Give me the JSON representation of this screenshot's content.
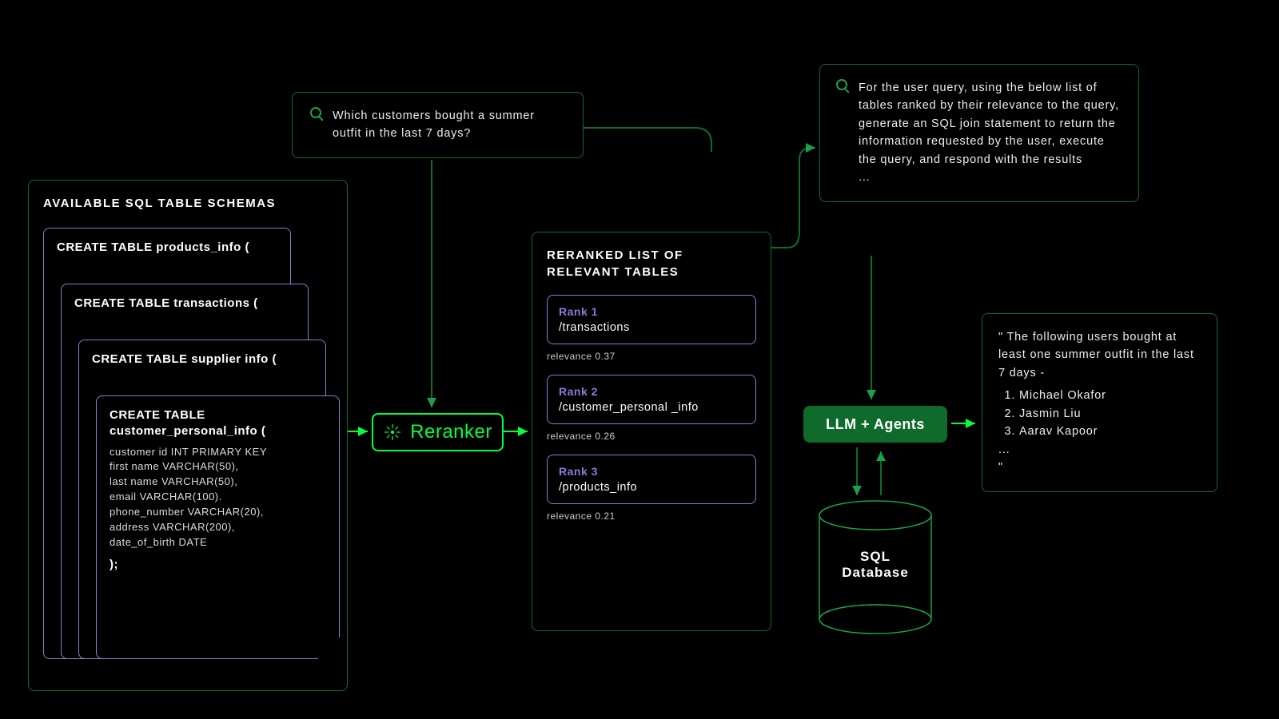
{
  "query_box": {
    "text": "Which customers bought a summer outfit in the last 7 days?"
  },
  "schemas_box": {
    "title": "AVAILABLE SQL TABLE SCHEMAS",
    "cards": [
      {
        "header": "CREATE TABLE products_info ("
      },
      {
        "header": "CREATE TABLE transactions ("
      },
      {
        "header": "CREATE TABLE supplier info ("
      },
      {
        "header": "CREATE TABLE customer_personal_info (",
        "fields": [
          "customer id INT PRIMARY KEY",
          "first name VARCHAR(50),",
          "last name VARCHAR(50),",
          "email VARCHAR(100).",
          "phone_number VARCHAR(20),",
          "address VARCHAR(200),",
          "date_of_birth DATE"
        ],
        "closer": ");"
      }
    ]
  },
  "reranker": {
    "label": "Reranker"
  },
  "reranked_box": {
    "title": "RERANKED LIST OF RELEVANT TABLES",
    "items": [
      {
        "rank": "Rank 1",
        "path": "/transactions",
        "relevance": "relevance 0.37"
      },
      {
        "rank": "Rank 2",
        "path": "/customer_personal _info",
        "relevance": "relevance 0.26"
      },
      {
        "rank": "Rank 3",
        "path": "/products_info",
        "relevance": "relevance 0.21"
      }
    ]
  },
  "prompt_box": {
    "text": "For the user query, using the below list of tables ranked by their relevance to the query, generate an SQL join statement to return the information requested by the user, execute the query, and respond with the results",
    "ellipsis": "..."
  },
  "llm_box": {
    "label": "LLM + Agents"
  },
  "db": {
    "label1": "SQL",
    "label2": "Database"
  },
  "result_box": {
    "intro": "\" The following users bought at least one summer outfit in the last 7 days -",
    "items": [
      "Michael Okafor",
      "Jasmin Liu",
      "Aarav Kapoor"
    ],
    "ellipsis": "...",
    "close_quote": "\""
  }
}
